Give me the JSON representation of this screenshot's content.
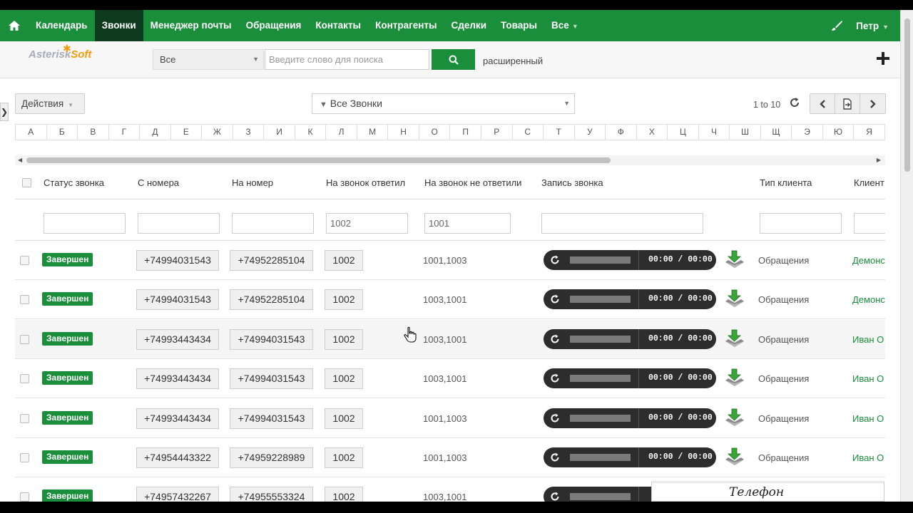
{
  "topnav": {
    "items": [
      {
        "label": "Календарь"
      },
      {
        "label": "Звонки"
      },
      {
        "label": "Менеджер почты"
      },
      {
        "label": "Обращения"
      },
      {
        "label": "Контакты"
      },
      {
        "label": "Контрагенты"
      },
      {
        "label": "Сделки"
      },
      {
        "label": "Товары"
      },
      {
        "label": "Все"
      }
    ],
    "active": "Звонки",
    "user": "Петр"
  },
  "logo": {
    "part1": "Asterisk",
    "part2": "Soft"
  },
  "search": {
    "scope": "Все",
    "placeholder": "Введите слово для поиска",
    "advanced": "расширенный"
  },
  "toolbar": {
    "actions": "Действия",
    "filter": "Все Звонки",
    "paging": "1 to 10"
  },
  "alphabet": [
    "А",
    "Б",
    "В",
    "Г",
    "Д",
    "Е",
    "Ж",
    "З",
    "И",
    "К",
    "Л",
    "М",
    "Н",
    "О",
    "П",
    "Р",
    "С",
    "Т",
    "У",
    "Ф",
    "Х",
    "Ц",
    "Ч",
    "Ш",
    "Щ",
    "Э",
    "Ю",
    "Я"
  ],
  "table": {
    "headers": {
      "status": "Статус звонка",
      "from": "С номера",
      "to": "На номер",
      "answered": "На звонок ответил",
      "missed": "На звонок не ответили",
      "recording": "Запись звонка",
      "client_type": "Тип клиента",
      "client": "Клиент"
    },
    "filters": {
      "answered": "1002",
      "missed": "1001"
    },
    "rows": [
      {
        "status": "Завершен",
        "from": "+74994031543",
        "to": "+74952285104",
        "answered": "1002",
        "missed": "1001,1003",
        "time": "00:00 / 00:00",
        "client_type": "Обращения",
        "client": "Демонс"
      },
      {
        "status": "Завершен",
        "from": "+74994031543",
        "to": "+74952285104",
        "answered": "1002",
        "missed": "1003,1001",
        "time": "00:00 / 00:00",
        "client_type": "Обращения",
        "client": "Демонс"
      },
      {
        "status": "Завершен",
        "from": "+74993443434",
        "to": "+74994031543",
        "answered": "1002",
        "missed": "1003,1001",
        "time": "00:00 / 00:00",
        "client_type": "Обращения",
        "client": "Иван О"
      },
      {
        "status": "Завершен",
        "from": "+74993443434",
        "to": "+74994031543",
        "answered": "1002",
        "missed": "1003,1001",
        "time": "00:00 / 00:00",
        "client_type": "Обращения",
        "client": "Иван О"
      },
      {
        "status": "Завершен",
        "from": "+74993443434",
        "to": "+74994031543",
        "answered": "1002",
        "missed": "1001,1003",
        "time": "00:00 / 00:00",
        "client_type": "Обращения",
        "client": "Иван О"
      },
      {
        "status": "Завершен",
        "from": "+74954443322",
        "to": "+74959228989",
        "answered": "1002",
        "missed": "1001,1003",
        "time": "00:00 / 00:00",
        "client_type": "Обращения",
        "client": "Иван О"
      },
      {
        "status": "Завершен",
        "from": "+74957432267",
        "to": "+74955553324",
        "answered": "1002",
        "missed": "1003,1001",
        "time": "",
        "client_type": "",
        "client": ""
      }
    ]
  },
  "phone_widget": {
    "label": "Телефон"
  },
  "colors": {
    "brand_green": "#1a8e3a",
    "active_nav": "#0e3b1d",
    "accent_orange": "#f39c12"
  },
  "icons": [
    "home-icon",
    "brush-icon",
    "search-icon",
    "plus-icon",
    "refresh-icon",
    "chevron-left-icon",
    "export-icon",
    "chevron-right-icon",
    "play-icon",
    "download-icon",
    "filter-icon"
  ]
}
